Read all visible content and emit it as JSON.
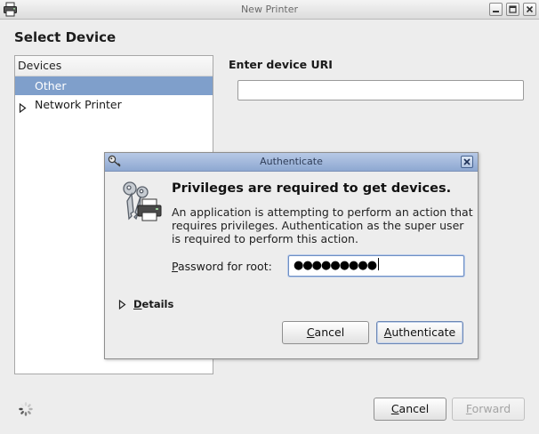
{
  "window": {
    "title": "New Printer",
    "app_icon": "printer-icon",
    "controls": [
      "minimize-icon",
      "maximize-icon",
      "close-icon"
    ]
  },
  "select_device": {
    "title": "Select Device",
    "devices_header": "Devices",
    "devices": [
      {
        "label": "Other",
        "selected": true,
        "expandable": false
      },
      {
        "label": "Network Printer",
        "selected": false,
        "expandable": true
      }
    ]
  },
  "uri": {
    "title": "Enter device URI",
    "value": ""
  },
  "footer": {
    "cancel_label": "Cancel",
    "cancel_mnemonic": "C",
    "cancel_rest": "ancel",
    "forward_label": "Forward",
    "forward_mnemonic": "F",
    "forward_rest": "orward",
    "forward_enabled": false,
    "spinner_icon": "spinner-icon"
  },
  "auth_dialog": {
    "title": "Authenticate",
    "heading": "Privileges are required to get devices.",
    "message": "An application is attempting to perform an action that requires privileges. Authentication as the super user is required to perform this action.",
    "password_label": "Password for root:",
    "password_label_mnemonic": "P",
    "password_label_rest": "assword for root:",
    "password_masked": "●●●●●●●●●",
    "details_label": "Details",
    "details_mnemonic": "D",
    "details_rest": "etails",
    "cancel_label": "Cancel",
    "cancel_mnemonic": "C",
    "cancel_rest": "ancel",
    "authenticate_label": "Authenticate",
    "authenticate_mnemonic": "A",
    "authenticate_rest": "uthenticate",
    "icons": [
      "key-icon",
      "keys-printer-icon",
      "close-icon",
      "expander-right-icon"
    ]
  },
  "colors": {
    "selection": "#7f9fcb",
    "dialog_titlebar": "#a3b9dc",
    "window_bg": "#ededed",
    "focus_border": "#6e8fc4"
  }
}
